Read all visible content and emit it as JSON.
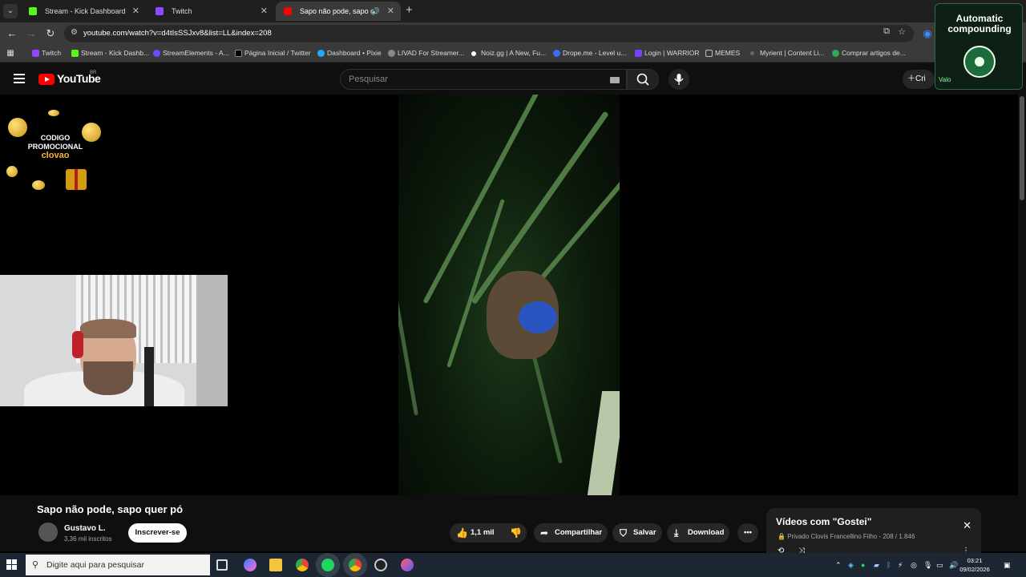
{
  "browser": {
    "tabs": [
      {
        "label": "Stream - Kick Dashboard",
        "color": "#53fc18"
      },
      {
        "label": "Twitch",
        "color": "#9146ff"
      },
      {
        "label": "Sapo não pode, sapo quer pó",
        "color": "#ff0000"
      }
    ],
    "url": "youtube.com/watch?v=d4tIsSSJxv8&list=LL&index=208",
    "bookmarks": [
      {
        "label": "Twitch",
        "color": "#9146ff"
      },
      {
        "label": "Stream - Kick Dashb...",
        "color": "#53fc18"
      },
      {
        "label": "StreamElements - A...",
        "color": "#6d4cff"
      },
      {
        "label": "Página Inicial / Twitter",
        "color": "#000000"
      },
      {
        "label": "Dashboard • Pixie",
        "color": "#22aaff"
      },
      {
        "label": "LIVAD For Streamer...",
        "color": "#888888"
      },
      {
        "label": "Noiz.gg | A New, Fu...",
        "color": "#ffffff"
      },
      {
        "label": "Drope.me - Level u...",
        "color": "#3b6cff"
      },
      {
        "label": "Login | WARRIOR",
        "color": "#7b3fff"
      },
      {
        "label": "MEMES",
        "color": "#bbbbbb"
      },
      {
        "label": "Myrient | Content Li...",
        "color": "#666666"
      },
      {
        "label": "Comprar artigos de...",
        "color": "#34a853"
      }
    ]
  },
  "youtube": {
    "logo_text": "YouTube",
    "country": "BR",
    "search_placeholder": "Pesquisar",
    "create_label": "Cri"
  },
  "overlay": {
    "promo_line1": "CODIGO",
    "promo_line2": "PROMOCIONAL",
    "promo_code": "clovao",
    "extension_title": "Automatic compounding",
    "extension_badge": "Valo"
  },
  "video": {
    "title": "Sapo não pode, sapo quer pó",
    "channel_name": "Gustavo L.",
    "subscribers": "3,36 mil inscritos",
    "subscribe_label": "Inscrever-se",
    "likes": "1,1 mil",
    "share_label": "Compartilhar",
    "save_label": "Salvar",
    "download_label": "Download"
  },
  "playlist": {
    "title": "Vídeos com \"Gostei\"",
    "meta": "Privado Clovis Francellino Filho - 208 / 1.846"
  },
  "taskbar": {
    "search_placeholder": "Digite aqui para pesquisar",
    "time": "03:21",
    "date": "09/02/2026"
  }
}
